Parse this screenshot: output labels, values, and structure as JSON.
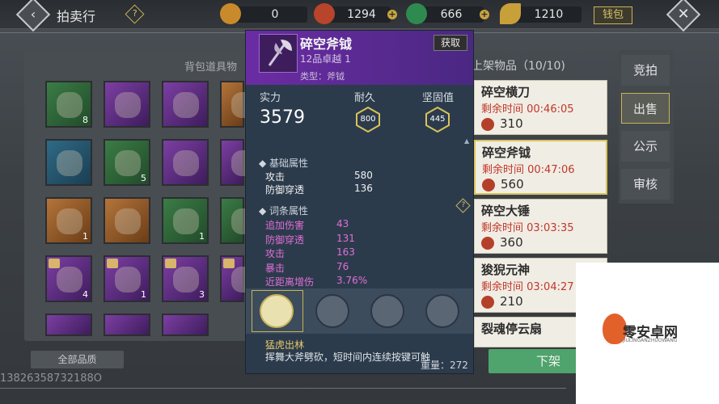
{
  "header": {
    "title": "拍卖行",
    "help": "?",
    "back": "‹",
    "close": "✕",
    "wallet_label": "钱包",
    "currencies": [
      {
        "name": "coin-bronze",
        "value": "0",
        "color": "#c98a2c"
      },
      {
        "name": "coin-red",
        "value": "1294",
        "color": "#b8442c"
      },
      {
        "name": "coin-jade",
        "value": "666",
        "color": "#2f8a4f"
      },
      {
        "name": "coin-gold-leaf",
        "value": "1210",
        "color": "#c8a03a"
      }
    ],
    "plus": "+"
  },
  "bag": {
    "title": "背包道具物",
    "filter_label": "全部品质",
    "slots": [
      {
        "color": "green",
        "count": "8"
      },
      {
        "color": "purple",
        "count": ""
      },
      {
        "color": "purple",
        "count": ""
      },
      {
        "color": "orange",
        "count": ""
      },
      {
        "color": "blue",
        "count": ""
      },
      {
        "color": "green",
        "count": "5"
      },
      {
        "color": "purple",
        "count": ""
      },
      {
        "color": "purple",
        "count": ""
      },
      {
        "color": "orange",
        "count": "1"
      },
      {
        "color": "orange",
        "count": ""
      },
      {
        "color": "green",
        "count": "1"
      },
      {
        "color": "green",
        "count": ""
      },
      {
        "color": "purple",
        "count": "4"
      },
      {
        "color": "purple",
        "count": "1"
      },
      {
        "color": "purple",
        "count": "3"
      },
      {
        "color": "purple",
        "count": ""
      }
    ]
  },
  "phone": "13826358732188O",
  "listings": {
    "title": "上架物品（10/10)",
    "items": [
      {
        "name": "碎空横刀",
        "time": "剩余时间 00:46:05",
        "price": "310"
      },
      {
        "name": "碎空斧钺",
        "time": "剩余时间 00:47:06",
        "price": "560"
      },
      {
        "name": "碎空大锤",
        "time": "剩余时间 03:03:35",
        "price": "360"
      },
      {
        "name": "狻猊元神",
        "time": "剩余时间 03:04:27",
        "price": "210"
      },
      {
        "name": "裂魂停云扇",
        "time": "",
        "price": ""
      }
    ],
    "shelf_button": "下架"
  },
  "tabs": [
    "竞拍",
    "出售",
    "公示",
    "审核"
  ],
  "tooltip": {
    "name": "碎空斧钺",
    "grade": "12品卓越 1",
    "type": "类型：斧钺",
    "get_button": "获取",
    "power_label": "实力",
    "power_value": "3579",
    "durability_label": "耐久",
    "durability_value": "800",
    "solid_label": "坚固值",
    "solid_value": "445",
    "base_title": "基础属性",
    "base_attrs": [
      {
        "k": "攻击",
        "v": "580"
      },
      {
        "k": "防御穿透",
        "v": "136"
      }
    ],
    "affix_title": "词条属性",
    "affix_attrs": [
      {
        "k": "追加伤害",
        "v": "43"
      },
      {
        "k": "防御穿透",
        "v": "131"
      },
      {
        "k": "攻击",
        "v": "163"
      },
      {
        "k": "暴击",
        "v": "76"
      },
      {
        "k": "近距离增伤",
        "v": "3.76%"
      }
    ],
    "skill_name": "猛虎出林",
    "skill_desc": "挥舞大斧劈砍，短时间内连续按键可触",
    "weight": "重量：272"
  },
  "watermark": {
    "text": "零安卓网",
    "sub": "JIULINGANZHUOWANG"
  }
}
